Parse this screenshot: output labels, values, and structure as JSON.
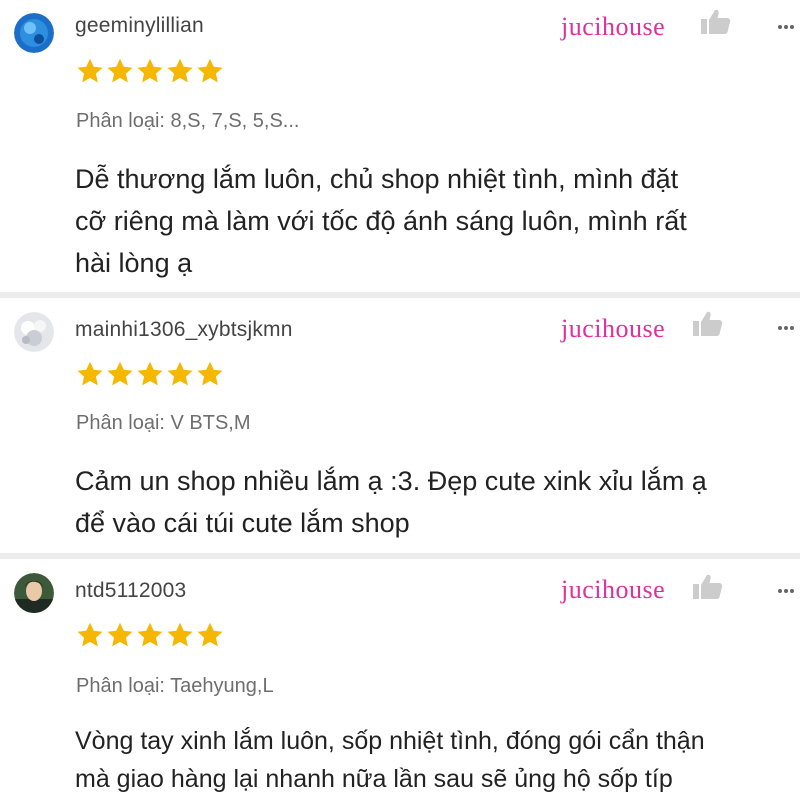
{
  "reviews": [
    {
      "username": "geeminylillian",
      "shop_name": "jucihouse",
      "rating": 5,
      "variation": "Phân loại: 8,S, 7,S, 5,S...",
      "comment_lines": [
        "Dễ thương lắm luôn, chủ shop nhiệt tình, mình đặt",
        "cỡ riêng mà làm với tốc độ ánh sáng luôn, mình rất",
        "hài lòng ạ"
      ]
    },
    {
      "username": "mainhi1306_xybtsjkmn",
      "shop_name": "jucihouse",
      "rating": 5,
      "variation": "Phân loại: V BTS,M",
      "comment_lines": [
        "Cảm un shop nhiều lắm ạ :3. Đẹp cute xink xỉu lắm ạ",
        "để vào cái túi cute lắm shop"
      ]
    },
    {
      "username": "ntd5112003",
      "shop_name": "jucihouse",
      "rating": 5,
      "variation": "Phân loại: Taehyung,L",
      "comment_lines": [
        "Vòng tay xinh lắm luôn, sốp nhiệt tình, đóng gói cẩn thận",
        "mà giao hàng lại nhanh nữa lần sau sẽ ủng hộ sốp típ"
      ]
    }
  ],
  "colors": {
    "star": "#f5b700",
    "shop_name": "#e0309e",
    "divider": "#ececec",
    "like_icon": "#cccccc"
  },
  "icons": [
    "avatar",
    "star-icon",
    "thumbs-up-icon",
    "more-options-icon"
  ]
}
